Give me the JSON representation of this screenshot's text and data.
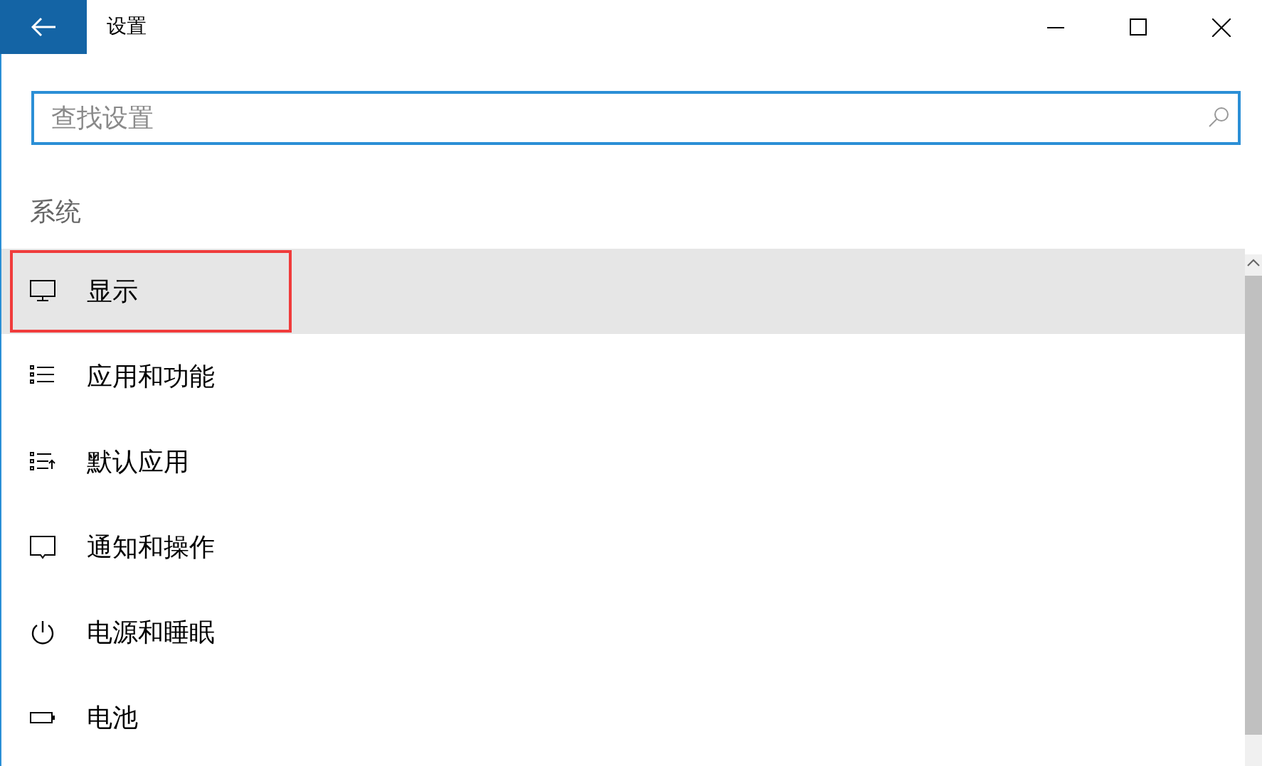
{
  "window": {
    "title": "设置"
  },
  "search": {
    "placeholder": "查找设置"
  },
  "section": {
    "title": "系统"
  },
  "items": [
    {
      "label": "显示",
      "selected": true,
      "annotated": true
    },
    {
      "label": "应用和功能",
      "selected": false,
      "annotated": false
    },
    {
      "label": "默认应用",
      "selected": false,
      "annotated": false
    },
    {
      "label": "通知和操作",
      "selected": false,
      "annotated": false
    },
    {
      "label": "电源和睡眠",
      "selected": false,
      "annotated": false
    },
    {
      "label": "电池",
      "selected": false,
      "annotated": false
    }
  ]
}
